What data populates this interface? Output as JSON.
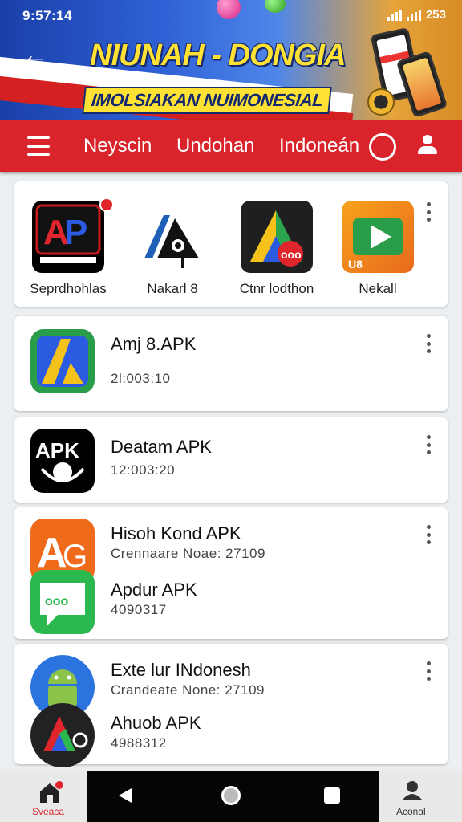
{
  "status_bar": {
    "time": "9:57:14",
    "battery": "253"
  },
  "banner": {
    "title": "NIUNAH - DONGIA",
    "subtitle": "IMOLSIAKAN NUIMONESIAL"
  },
  "nav": {
    "tabs": [
      "Neyscin",
      "Undohan",
      "Indoneán"
    ]
  },
  "featured": {
    "items": [
      {
        "label": "Seprdhohlas",
        "icon": "ap-logo-icon"
      },
      {
        "label": "Nakarl 8",
        "icon": "triangle-logo-icon"
      },
      {
        "label": "Ctnr lodthon",
        "icon": "colorful-triangle-icon"
      },
      {
        "label": "Nekall",
        "icon": "play-store-icon"
      }
    ]
  },
  "apps": [
    {
      "title": "Amj 8.APK",
      "meta": "2l:003:10",
      "icon": "yellow-a-icon"
    },
    {
      "title": "Deatam APK",
      "meta": "12:003:20",
      "icon": "apk-logo-icon"
    },
    {
      "title": "Hisoh Kond APK",
      "meta": "Crennaare Noae: 27109",
      "icon": "orange-a-icon"
    },
    {
      "title": "Apdur APK",
      "meta": "4090317",
      "icon": "green-chat-icon"
    },
    {
      "title": "Exte lur INdonesh",
      "meta": "Crandeate None: 27109",
      "icon": "android-icon"
    },
    {
      "title": "Ahuob APK",
      "meta": "4988312",
      "icon": "dark-triangle-icon"
    }
  ],
  "bottom_nav": {
    "home_label": "Sveaca",
    "account_label": "Aconal"
  },
  "colors": {
    "nav_red": "#d8242a",
    "banner_blue": "#2f61d6",
    "banner_yellow": "#ffe234"
  }
}
